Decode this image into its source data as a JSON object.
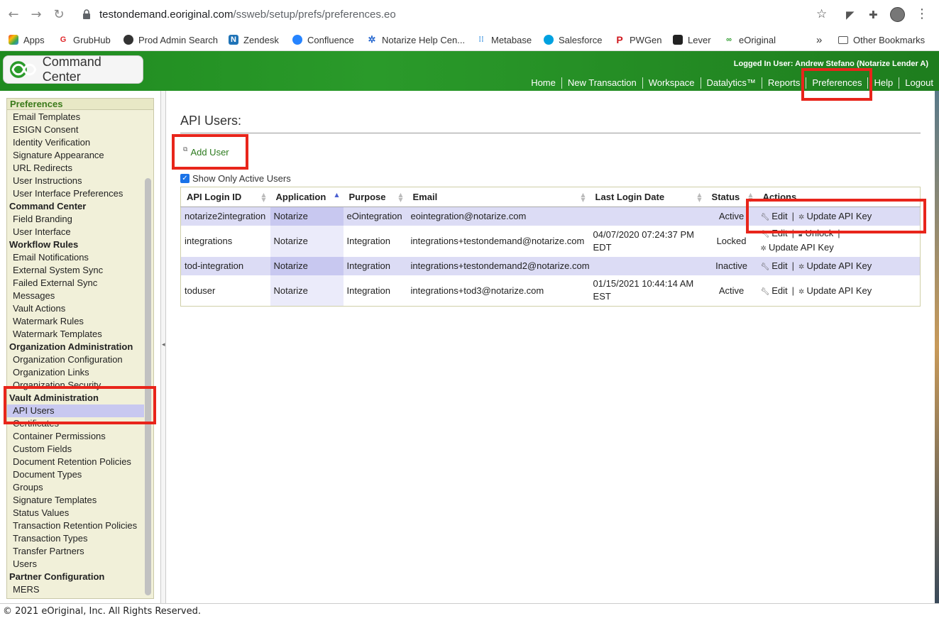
{
  "browser": {
    "url_host": "testondemand.eoriginal.com",
    "url_path": "/ssweb/setup/prefs/preferences.eo",
    "bookmarks": [
      "Apps",
      "GrubHub",
      "Prod Admin Search",
      "Zendesk",
      "Confluence",
      "Notarize Help Cen...",
      "Metabase",
      "Salesforce",
      "PWGen",
      "Lever",
      "eOriginal"
    ],
    "overflow": "»",
    "other_bookmarks": "Other Bookmarks"
  },
  "header": {
    "logo_text": "Command Center",
    "logged_in": "Logged In User: Andrew Stefano (Notarize Lender A)",
    "nav": [
      "Home",
      "New Transaction",
      "Workspace",
      "Datalytics™",
      "Reports",
      "Preferences",
      "Help",
      "Logout"
    ]
  },
  "sidebar": {
    "title": "Preferences",
    "entries": [
      {
        "type": "item",
        "label": "Email Templates"
      },
      {
        "type": "item",
        "label": "ESIGN Consent"
      },
      {
        "type": "item",
        "label": "Identity Verification"
      },
      {
        "type": "item",
        "label": "Signature Appearance"
      },
      {
        "type": "item",
        "label": "URL Redirects"
      },
      {
        "type": "item",
        "label": "User Instructions"
      },
      {
        "type": "item",
        "label": "User Interface Preferences"
      },
      {
        "type": "group",
        "label": "Command Center"
      },
      {
        "type": "item",
        "label": "Field Branding"
      },
      {
        "type": "item",
        "label": "User Interface"
      },
      {
        "type": "group",
        "label": "Workflow Rules"
      },
      {
        "type": "item",
        "label": "Email Notifications"
      },
      {
        "type": "item",
        "label": "External System Sync"
      },
      {
        "type": "item",
        "label": "Failed External Sync"
      },
      {
        "type": "item",
        "label": "Messages"
      },
      {
        "type": "item",
        "label": "Vault Actions"
      },
      {
        "type": "item",
        "label": "Watermark Rules"
      },
      {
        "type": "item",
        "label": "Watermark Templates"
      },
      {
        "type": "group",
        "label": "Organization Administration"
      },
      {
        "type": "item",
        "label": "Organization Configuration"
      },
      {
        "type": "item",
        "label": "Organization Links"
      },
      {
        "type": "item",
        "label": "Organization Security"
      },
      {
        "type": "group",
        "label": "Vault Administration"
      },
      {
        "type": "item",
        "label": "API Users",
        "selected": true
      },
      {
        "type": "item",
        "label": "Certificates"
      },
      {
        "type": "item",
        "label": "Container Permissions"
      },
      {
        "type": "item",
        "label": "Custom Fields"
      },
      {
        "type": "item",
        "label": "Document Retention Policies"
      },
      {
        "type": "item",
        "label": "Document Types"
      },
      {
        "type": "item",
        "label": "Groups"
      },
      {
        "type": "item",
        "label": "Signature Templates"
      },
      {
        "type": "item",
        "label": "Status Values"
      },
      {
        "type": "item",
        "label": "Transaction Retention Policies"
      },
      {
        "type": "item",
        "label": "Transaction Types"
      },
      {
        "type": "item",
        "label": "Transfer Partners"
      },
      {
        "type": "item",
        "label": "Users"
      },
      {
        "type": "group",
        "label": "Partner Configuration"
      },
      {
        "type": "item",
        "label": "MERS"
      }
    ]
  },
  "main": {
    "title": "API Users:",
    "add_user": "Add User",
    "show_active_label": "Show Only Active Users",
    "show_active_checked": true,
    "columns": [
      "API Login ID",
      "Application",
      "Purpose",
      "Email",
      "Last Login Date",
      "Status",
      "Actions"
    ],
    "rows": [
      {
        "login": "notarize2integration",
        "app": "Notarize",
        "purpose": "eOintegration",
        "email": "eointegration@notarize.com",
        "date1": "",
        "date2": "",
        "status": "Active",
        "actions": [
          "Edit",
          "Update API Key"
        ]
      },
      {
        "login": "integrations",
        "app": "Notarize",
        "purpose": "Integration",
        "email": "integrations+testondemand@notarize.com",
        "date1": "04/07/2020 07:24:37 PM",
        "date2": "EDT",
        "status": "Locked",
        "actions": [
          "Edit",
          "Unlock",
          "Update API Key"
        ]
      },
      {
        "login": "tod-integration",
        "app": "Notarize",
        "purpose": "Integration",
        "email": "integrations+testondemand2@notarize.com",
        "date1": "",
        "date2": "",
        "status": "Inactive",
        "actions": [
          "Edit",
          "Update API Key"
        ]
      },
      {
        "login": "toduser",
        "app": "Notarize",
        "purpose": "Integration",
        "email": "integrations+tod3@notarize.com",
        "date1": "01/15/2021 10:44:14 AM",
        "date2": "EST",
        "status": "Active",
        "actions": [
          "Edit",
          "Update API Key"
        ]
      }
    ]
  },
  "footer": {
    "text": "© 2021 eOriginal, Inc. All Rights Reserved."
  },
  "colors": {
    "header_green": "#1f8a1f",
    "link_green": "#2c7a1e",
    "highlight_red": "#e8251b",
    "selected_row": "#dcdcf5"
  }
}
